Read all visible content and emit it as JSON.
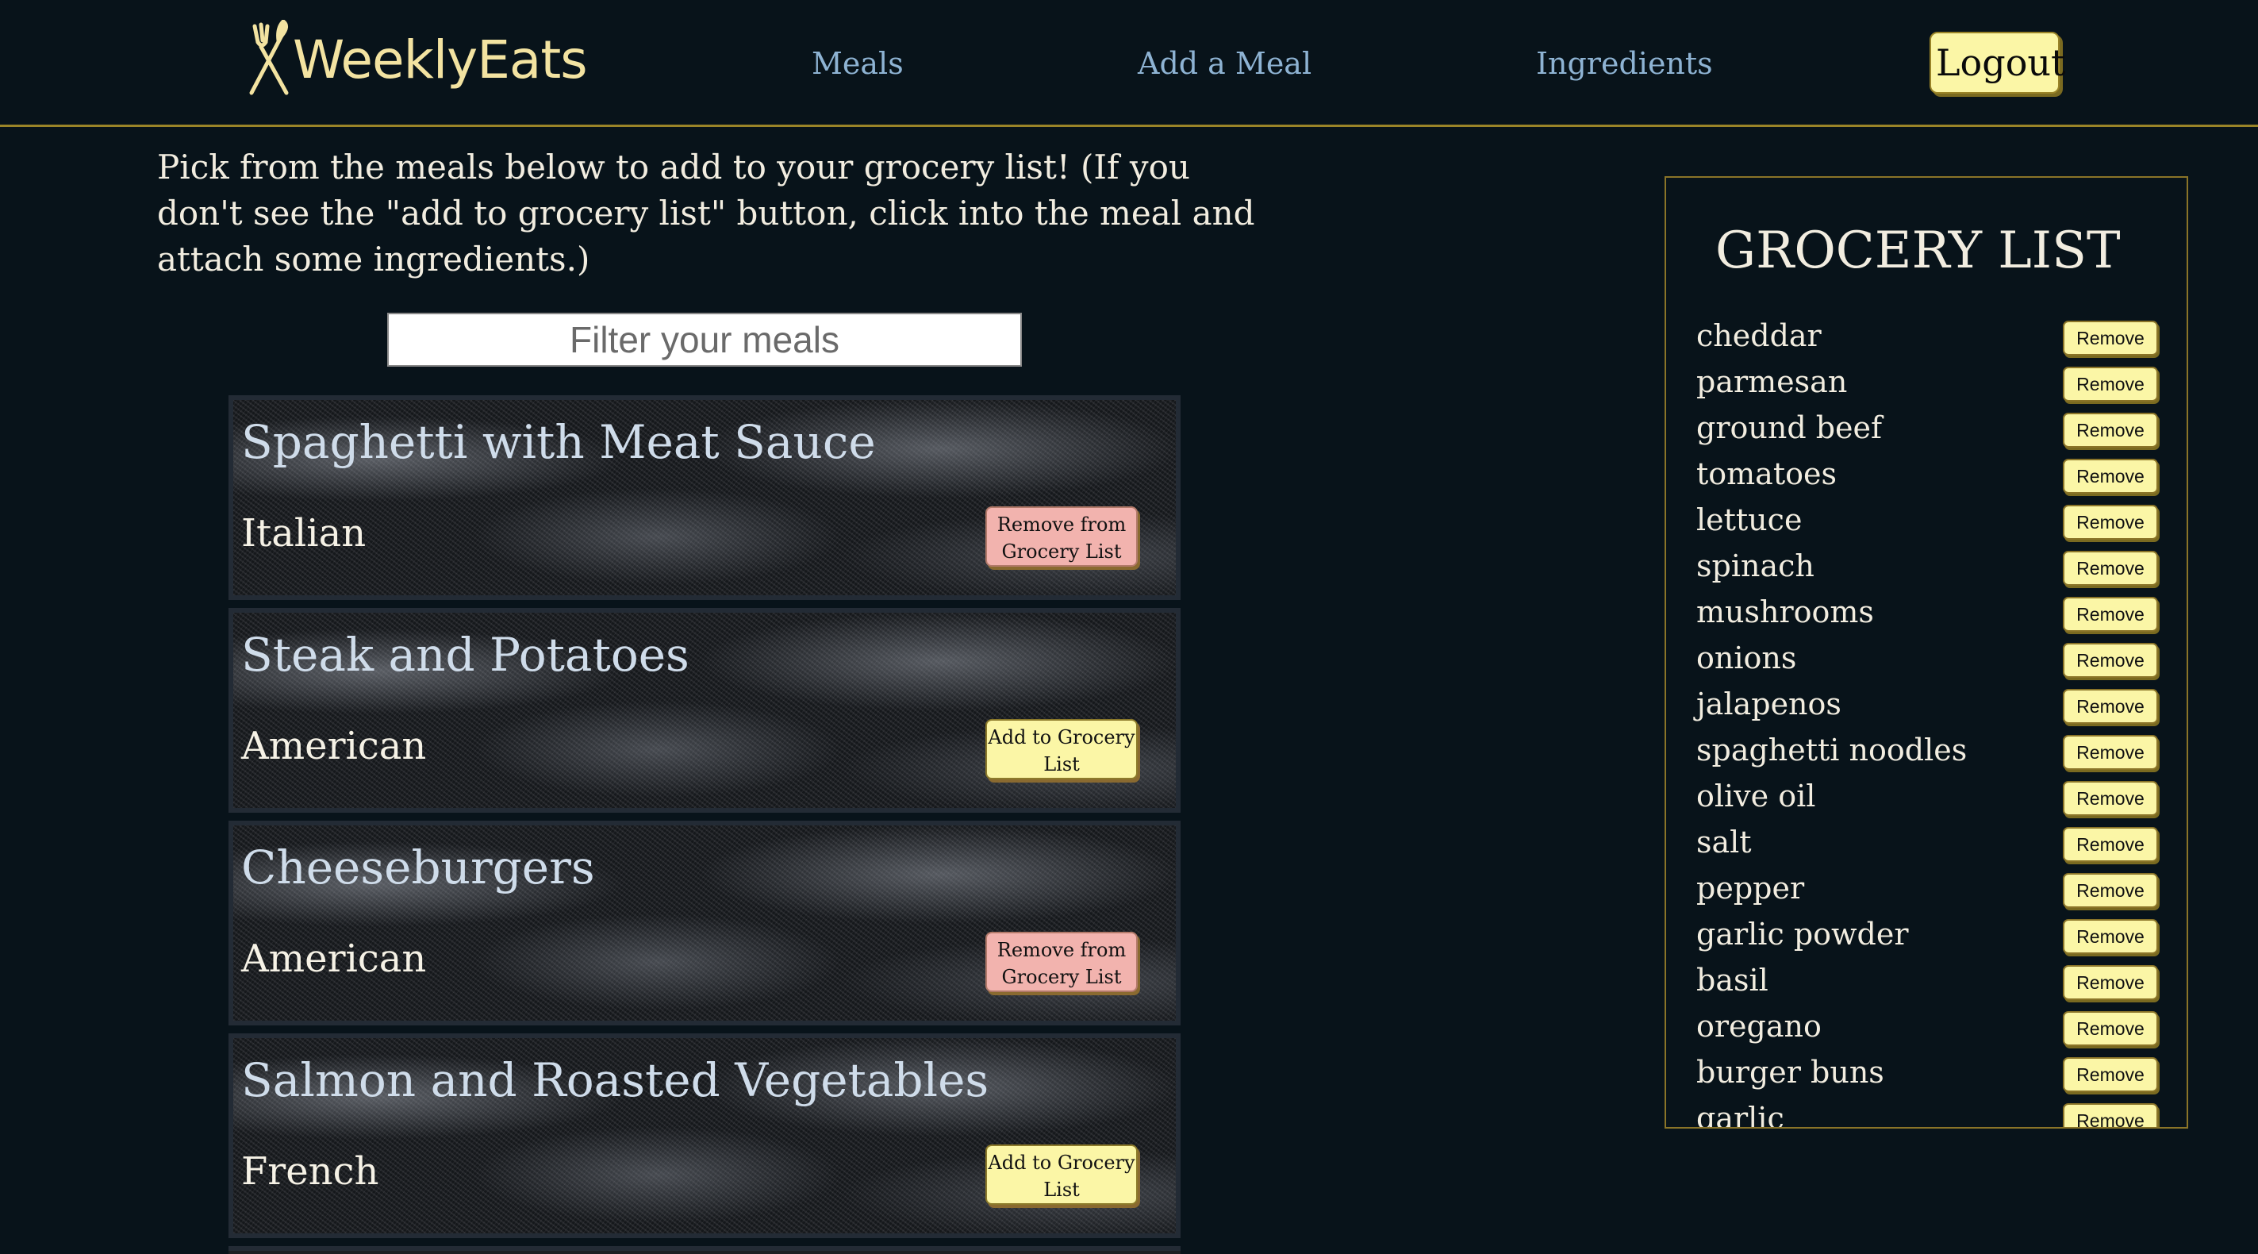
{
  "nav": {
    "brand": "WeeklyEats",
    "links": [
      "Meals",
      "Add a Meal",
      "Ingredients"
    ],
    "logout": "Logout"
  },
  "intro": "Pick from the meals below to add to your grocery list! (If you don't see the \"add to grocery list\" button, click into the meal and attach some ingredients.)",
  "filter": {
    "placeholder": "Filter your meals",
    "value": ""
  },
  "meals": [
    {
      "name": "Spaghetti with Meat Sauce",
      "cuisine": "Italian",
      "action": "Remove from Grocery List",
      "state": "remove"
    },
    {
      "name": "Steak and Potatoes",
      "cuisine": "American",
      "action": "Add to Grocery List",
      "state": "add"
    },
    {
      "name": "Cheeseburgers",
      "cuisine": "American",
      "action": "Remove from Grocery List",
      "state": "remove"
    },
    {
      "name": "Salmon and Roasted Vegetables",
      "cuisine": "French",
      "action": "Add to Grocery List",
      "state": "add"
    }
  ],
  "grocery": {
    "title": "GROCERY LIST",
    "remove_label": "Remove",
    "items": [
      "cheddar",
      "parmesan",
      "ground beef",
      "tomatoes",
      "lettuce",
      "spinach",
      "mushrooms",
      "onions",
      "jalapenos",
      "spaghetti noodles",
      "olive oil",
      "salt",
      "pepper",
      "garlic powder",
      "basil",
      "oregano",
      "burger buns",
      "garlic"
    ]
  },
  "colors": {
    "background": "#08131a",
    "accent_gold": "#9a8428",
    "button_yellow": "#fbf6a6",
    "button_pink": "#f2b3ae",
    "link_blue": "#8eb3d3"
  },
  "icons": {
    "logo": "fork-knife-icon"
  }
}
